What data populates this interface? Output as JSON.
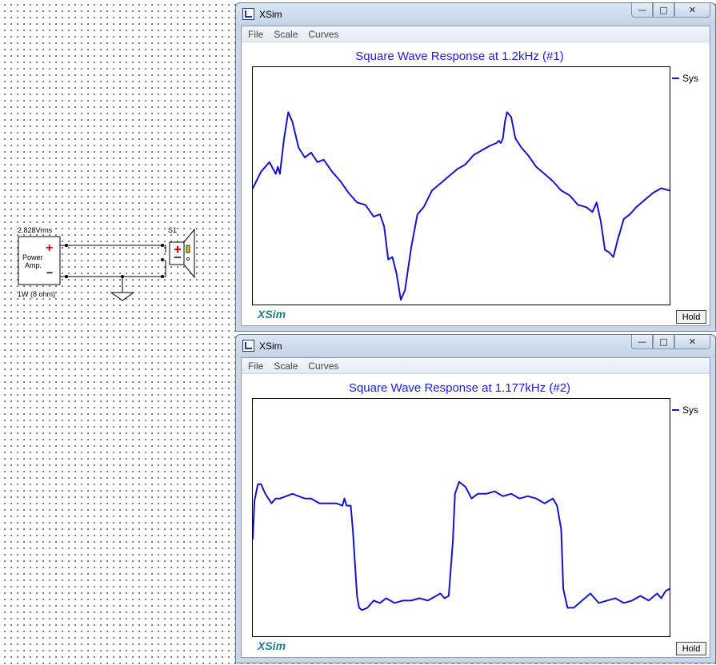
{
  "schematic": {
    "source_voltage": "2.828Vrms",
    "source_name_line1": "Power",
    "source_name_line2": "Amp.",
    "source_rating": "1W (8 ohm)",
    "driver_label": "S1",
    "plus_sign": "+",
    "minus_sign": "−",
    "colors": {
      "plus": "#e00000",
      "wire": "#000000",
      "driver": "#e0c000"
    }
  },
  "windows": [
    {
      "title": "XSim",
      "menu": [
        "File",
        "Scale",
        "Curves"
      ],
      "chart_title": "Square Wave Response at 1.2kHz (#1)",
      "legend": "Sys",
      "brand": "XSim",
      "hold_label": "Hold",
      "chart_data": {
        "type": "line",
        "title": "Square Wave Response at 1.2kHz (#1)",
        "xlabel": "",
        "ylabel": "",
        "xlim": [
          0,
          1
        ],
        "ylim": [
          0,
          1
        ],
        "grid": false,
        "legend_position": "right",
        "series": [
          {
            "name": "Sys",
            "color": "#1414c8",
            "x": [
              0,
              0.02,
              0.04,
              0.055,
              0.06,
              0.065,
              0.075,
              0.085,
              0.095,
              0.11,
              0.125,
              0.14,
              0.155,
              0.17,
              0.19,
              0.21,
              0.23,
              0.25,
              0.27,
              0.29,
              0.305,
              0.315,
              0.325,
              0.335,
              0.345,
              0.355,
              0.365,
              0.38,
              0.395,
              0.41,
              0.43,
              0.45,
              0.47,
              0.49,
              0.51,
              0.53,
              0.55,
              0.57,
              0.585,
              0.59,
              0.595,
              0.6,
              0.605,
              0.61,
              0.62,
              0.63,
              0.645,
              0.66,
              0.68,
              0.7,
              0.72,
              0.74,
              0.76,
              0.78,
              0.8,
              0.815,
              0.825,
              0.835,
              0.845,
              0.855,
              0.865,
              0.875,
              0.89,
              0.905,
              0.92,
              0.94,
              0.96,
              0.98,
              1.0
            ],
            "y": [
              0.49,
              0.56,
              0.6,
              0.55,
              0.58,
              0.55,
              0.7,
              0.81,
              0.77,
              0.66,
              0.62,
              0.64,
              0.6,
              0.61,
              0.56,
              0.52,
              0.47,
              0.43,
              0.42,
              0.37,
              0.38,
              0.33,
              0.19,
              0.2,
              0.13,
              0.02,
              0.06,
              0.24,
              0.38,
              0.41,
              0.48,
              0.51,
              0.54,
              0.57,
              0.59,
              0.63,
              0.65,
              0.67,
              0.68,
              0.69,
              0.68,
              0.7,
              0.77,
              0.81,
              0.79,
              0.7,
              0.66,
              0.63,
              0.58,
              0.55,
              0.52,
              0.48,
              0.46,
              0.42,
              0.41,
              0.39,
              0.43,
              0.35,
              0.23,
              0.22,
              0.2,
              0.27,
              0.36,
              0.38,
              0.41,
              0.44,
              0.47,
              0.49,
              0.48
            ]
          }
        ]
      }
    },
    {
      "title": "XSim",
      "menu": [
        "File",
        "Scale",
        "Curves"
      ],
      "chart_title": "Square Wave Response at 1.177kHz (#2)",
      "legend": "Sys",
      "brand": "XSim",
      "hold_label": "Hold",
      "chart_data": {
        "type": "line",
        "title": "Square Wave Response at 1.177kHz (#2)",
        "xlabel": "",
        "ylabel": "",
        "xlim": [
          0,
          1
        ],
        "ylim": [
          0,
          1
        ],
        "grid": false,
        "legend_position": "right",
        "series": [
          {
            "name": "Sys",
            "color": "#1414c8",
            "x": [
              0,
              0.004,
              0.012,
              0.02,
              0.03,
              0.045,
              0.055,
              0.065,
              0.08,
              0.095,
              0.11,
              0.125,
              0.14,
              0.16,
              0.18,
              0.2,
              0.215,
              0.22,
              0.225,
              0.235,
              0.24,
              0.25,
              0.255,
              0.262,
              0.275,
              0.29,
              0.305,
              0.32,
              0.34,
              0.36,
              0.38,
              0.4,
              0.42,
              0.44,
              0.45,
              0.46,
              0.47,
              0.48,
              0.485,
              0.495,
              0.51,
              0.525,
              0.54,
              0.56,
              0.58,
              0.6,
              0.62,
              0.64,
              0.66,
              0.68,
              0.7,
              0.71,
              0.72,
              0.73,
              0.74,
              0.745,
              0.755,
              0.77,
              0.79,
              0.81,
              0.83,
              0.85,
              0.87,
              0.89,
              0.91,
              0.93,
              0.95,
              0.97,
              0.98,
              0.99,
              1.0
            ],
            "y": [
              0.41,
              0.57,
              0.64,
              0.64,
              0.6,
              0.56,
              0.58,
              0.58,
              0.59,
              0.6,
              0.59,
              0.58,
              0.58,
              0.56,
              0.56,
              0.56,
              0.55,
              0.58,
              0.55,
              0.55,
              0.45,
              0.17,
              0.12,
              0.11,
              0.12,
              0.15,
              0.14,
              0.16,
              0.14,
              0.15,
              0.15,
              0.16,
              0.15,
              0.17,
              0.18,
              0.16,
              0.17,
              0.4,
              0.6,
              0.65,
              0.63,
              0.58,
              0.6,
              0.6,
              0.61,
              0.59,
              0.6,
              0.58,
              0.59,
              0.58,
              0.56,
              0.57,
              0.58,
              0.55,
              0.45,
              0.2,
              0.12,
              0.12,
              0.15,
              0.18,
              0.14,
              0.15,
              0.16,
              0.14,
              0.15,
              0.17,
              0.15,
              0.18,
              0.16,
              0.19,
              0.2
            ]
          }
        ]
      }
    }
  ]
}
